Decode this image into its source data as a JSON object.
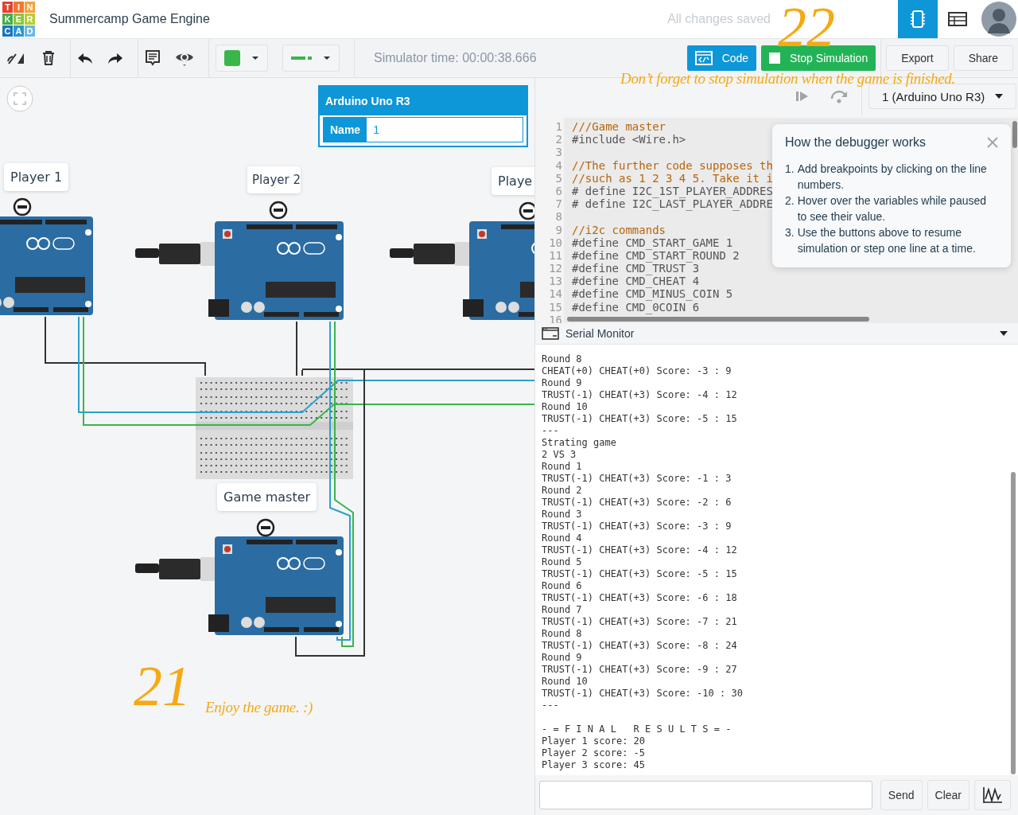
{
  "logo": [
    {
      "letter": "T",
      "color": "#e5412d"
    },
    {
      "letter": "I",
      "color": "#f0772f"
    },
    {
      "letter": "N",
      "color": "#f6a33b"
    },
    {
      "letter": "K",
      "color": "#3fae49"
    },
    {
      "letter": "E",
      "color": "#8cc43f"
    },
    {
      "letter": "R",
      "color": "#b5cf35"
    },
    {
      "letter": "C",
      "color": "#1b75bb"
    },
    {
      "letter": "A",
      "color": "#2a95d3"
    },
    {
      "letter": "D",
      "color": "#6cb8e2"
    }
  ],
  "project_title": "Summercamp Game Engine",
  "save_status": "All changes saved",
  "view_tabs": [
    {
      "kind": "circuit",
      "selected": true
    },
    {
      "kind": "list",
      "selected": false
    }
  ],
  "toolbar": {
    "simulator_time": "Simulator time: 00:00:38.666"
  },
  "buttons": {
    "code": "Code",
    "stop": "Stop Simulation",
    "export": "Export",
    "share": "Share"
  },
  "inspector": {
    "title": "Arduino Uno R3",
    "field_label": "Name",
    "field_value": "1"
  },
  "board_labels": [
    "Player 1",
    "Player 2",
    "Playe",
    "Game master"
  ],
  "debugger": {
    "step_disabled": true,
    "device": "1 (Arduino Uno R3)"
  },
  "code_lines": [
    {
      "number": "1",
      "kind": "comment",
      "text": "///Game master"
    },
    {
      "number": "2",
      "kind": "code",
      "text": "#include <Wire.h>"
    },
    {
      "number": "3",
      "kind": "blank"
    },
    {
      "number": "4",
      "kind": "comment",
      "text": "//The further code supposes th"
    },
    {
      "number": "5",
      "kind": "comment",
      "text": "//such as 1 2 3 4 5. Take it i"
    },
    {
      "number": "6",
      "kind": "code",
      "text": "# define I2C_1ST_PLAYER_ADDRES"
    },
    {
      "number": "7",
      "kind": "code",
      "text": "# define I2C_LAST_PLAYER_ADDRE"
    },
    {
      "number": "8",
      "kind": "blank"
    },
    {
      "number": "9",
      "kind": "comment",
      "text": "//i2c commands"
    },
    {
      "number": "10",
      "kind": "code",
      "text": "#define CMD_START_GAME 1"
    },
    {
      "number": "11",
      "kind": "code",
      "text": "#define CMD_START_ROUND 2"
    },
    {
      "number": "12",
      "kind": "code",
      "text": "#define CMD_TRUST 3"
    },
    {
      "number": "13",
      "kind": "code",
      "text": "#define CMD_CHEAT 4"
    },
    {
      "number": "14",
      "kind": "code",
      "text": "#define CMD_MINUS_COIN 5"
    },
    {
      "number": "15",
      "kind": "code",
      "text": "#define CMD_0COIN 6"
    },
    {
      "number": "16",
      "kind": "blank"
    }
  ],
  "debugger_help": {
    "title": "How the debugger works",
    "steps": [
      {
        "marker": "1.",
        "text": "Add breakpoints by clicking on the line numbers."
      },
      {
        "marker": "2.",
        "text": "Hover over the variables while paused to see their value."
      },
      {
        "marker": "3.",
        "text": "Use the buttons above to resume simulation or step one line at a time."
      }
    ]
  },
  "serial_monitor": {
    "title": "Serial Monitor",
    "lines": [
      "Round 8",
      "CHEAT(+0) CHEAT(+0) Score: -3 : 9",
      "Round 9",
      "TRUST(-1) CHEAT(+3) Score: -4 : 12",
      "Round 10",
      "TRUST(-1) CHEAT(+3) Score: -5 : 15",
      "---",
      "Strating game",
      "2 VS 3",
      "Round 1",
      "TRUST(-1) CHEAT(+3) Score: -1 : 3",
      "Round 2",
      "TRUST(-1) CHEAT(+3) Score: -2 : 6",
      "Round 3",
      "TRUST(-1) CHEAT(+3) Score: -3 : 9",
      "Round 4",
      "TRUST(-1) CHEAT(+3) Score: -4 : 12",
      "Round 5",
      "TRUST(-1) CHEAT(+3) Score: -5 : 15",
      "Round 6",
      "TRUST(-1) CHEAT(+3) Score: -6 : 18",
      "Round 7",
      "TRUST(-1) CHEAT(+3) Score: -7 : 21",
      "Round 8",
      "TRUST(-1) CHEAT(+3) Score: -8 : 24",
      "Round 9",
      "TRUST(-1) CHEAT(+3) Score: -9 : 27",
      "Round 10",
      "TRUST(-1) CHEAT(+3) Score: -10 : 30",
      "---"
    ],
    "results": [
      "- = F I N A L   R E S U L T S = -",
      "Player 1 score: 20",
      "Player 2 score: -5",
      "Player 3 score: 45"
    ],
    "send": "Send",
    "clear": "Clear"
  },
  "annotations": [
    {
      "kind": "number",
      "text": "22"
    },
    {
      "kind": "note",
      "text": "Don’t forget to stop simulation when the game is finished."
    },
    {
      "kind": "number",
      "text": "21"
    },
    {
      "kind": "note",
      "text": "Enjoy the game. :)"
    }
  ]
}
